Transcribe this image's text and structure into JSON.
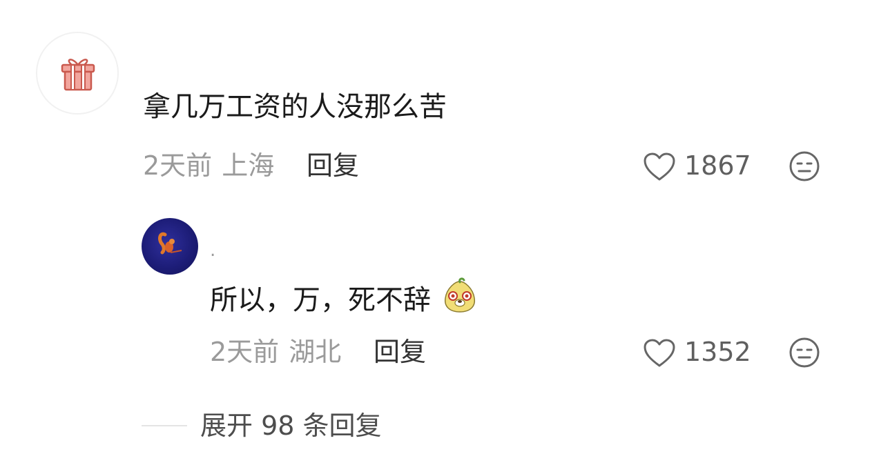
{
  "comment": {
    "avatar_icon": "gift-icon",
    "text": "拿几万工资的人没那么苦",
    "time": "2天前",
    "location": "上海",
    "reply_label": "回复",
    "like_count": "1867"
  },
  "reply": {
    "avatar_icon": "squirrel-avatar",
    "username": ".",
    "text": "所以，万，死不辞",
    "emoji": "yellow-creature-emoji",
    "time": "2天前",
    "location": "湖北",
    "reply_label": "回复",
    "like_count": "1352"
  },
  "expand_label": "展开 98 条回复",
  "colors": {
    "gift": "#e87a6e",
    "text": "#1a1a1a",
    "meta": "#9a9a9a"
  }
}
